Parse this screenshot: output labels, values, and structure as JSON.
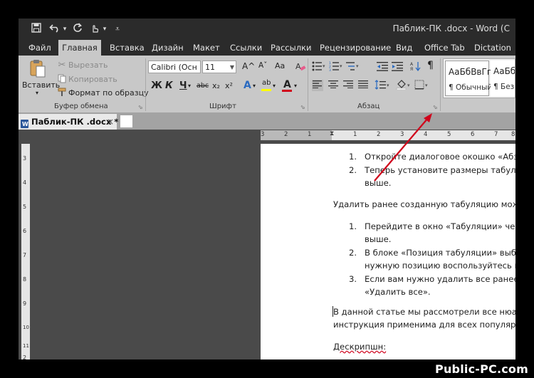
{
  "window": {
    "title": "Паблик-ПК .docx - Word (С"
  },
  "qat": {
    "icons": [
      "save-icon",
      "undo-icon",
      "redo-icon",
      "customize-icon"
    ],
    "undo_arrow": "▾"
  },
  "tabs": [
    {
      "label": "Файл"
    },
    {
      "label": "Главная"
    },
    {
      "label": "Вставка"
    },
    {
      "label": "Дизайн"
    },
    {
      "label": "Макет"
    },
    {
      "label": "Ссылки"
    },
    {
      "label": "Рассылки"
    },
    {
      "label": "Рецензирование"
    },
    {
      "label": "Вид"
    },
    {
      "label": "Office Tab"
    },
    {
      "label": "Dictation"
    }
  ],
  "clipboard": {
    "paste_label": "Вставить",
    "cut_label": "Вырезать",
    "copy_label": "Копировать",
    "format_painter_label": "Формат по образцу",
    "group_label": "Буфер обмена"
  },
  "font": {
    "font_name": "Calibri (Осн",
    "font_size": "11",
    "bold_label": "Ж",
    "italic_label": "К",
    "underline_label": "Ч",
    "strike_label": "abc",
    "sub_label": "x₂",
    "sup_label": "x²",
    "grow_label": "A^",
    "shrink_label": "Aˇ",
    "case_label": "Aa",
    "effects_label": "A",
    "highlight_label": "ab",
    "color_label": "A",
    "group_label": "Шрифт"
  },
  "paragraph": {
    "group_label": "Абзац",
    "pilcrow": "¶"
  },
  "styles": {
    "items": [
      {
        "sample": "АаБбВвГг,",
        "name": "¶ Обычный"
      },
      {
        "sample": "АаБбВ",
        "name": "¶ Без"
      }
    ]
  },
  "doc_tab": {
    "label": "Паблик-ПК .docx *",
    "close": "×"
  },
  "ruler": {
    "h_ticks": [
      "3",
      "2",
      "1",
      "1",
      "2",
      "3",
      "4",
      "5",
      "6",
      "7",
      "8"
    ],
    "v_ticks": [
      "3",
      "4",
      "5",
      "6",
      "7",
      "8",
      "9",
      "10",
      "11",
      "2"
    ]
  },
  "document": {
    "list1": [
      {
        "num": "1.",
        "lines": [
          "Откройте диалоговое окошко «Абзац"
        ]
      },
      {
        "num": "2.",
        "lines": [
          "Теперь установите размеры табуляци",
          "выше."
        ]
      }
    ],
    "para1": "Удалить ранее созданную табуляцию можно",
    "list2": [
      {
        "num": "1.",
        "lines": [
          "Перейдите в окно «Табуляции» чере",
          "выше."
        ]
      },
      {
        "num": "2.",
        "lines": [
          "В блоке «Позиция табуляции» выбер",
          "нужную позицию воспользуйтесь кно"
        ]
      },
      {
        "num": "3.",
        "lines": [
          "Если вам нужно удалить все ранее за",
          "«Удалить все»."
        ]
      }
    ],
    "para2_lines": [
      "В данной статье мы рассмотрели все нюансь",
      "инструкция применима для всех популярных"
    ],
    "para3": "Дескрипшн:"
  },
  "watermark": "Public-PC.com",
  "colors": {
    "titlebar": "#2b2b2b",
    "ribbon": "#c8c8c8",
    "arrow": "#d0021b",
    "font_color": "#d0021b",
    "highlight": "#ffff00"
  }
}
